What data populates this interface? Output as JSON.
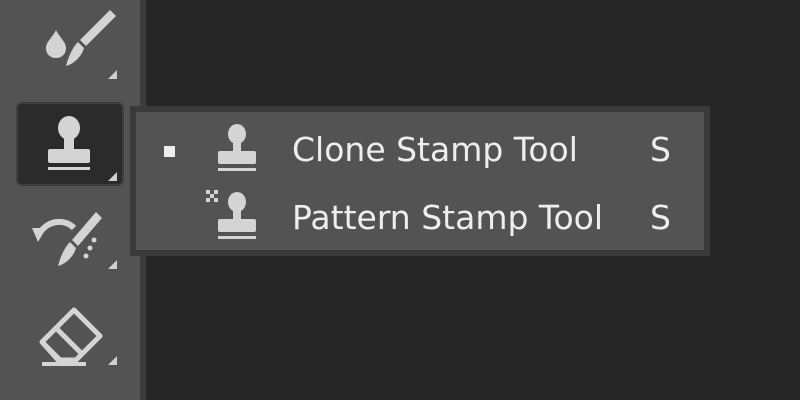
{
  "toolbar": {
    "tools": [
      {
        "icon": "brush-icon"
      },
      {
        "icon": "stamp-icon",
        "active": true
      },
      {
        "icon": "history-brush-icon"
      },
      {
        "icon": "eraser-icon"
      }
    ]
  },
  "flyout": {
    "items": [
      {
        "label": "Clone Stamp Tool",
        "shortcut": "S",
        "icon": "clone-stamp-icon",
        "selected": true
      },
      {
        "label": "Pattern Stamp Tool",
        "shortcut": "S",
        "icon": "pattern-stamp-icon",
        "selected": false
      }
    ]
  },
  "colors": {
    "toolbar_bg": "#535353",
    "canvas_bg": "#262626",
    "icon": "#d4d4d4",
    "active_bg": "#2b2b2b"
  }
}
